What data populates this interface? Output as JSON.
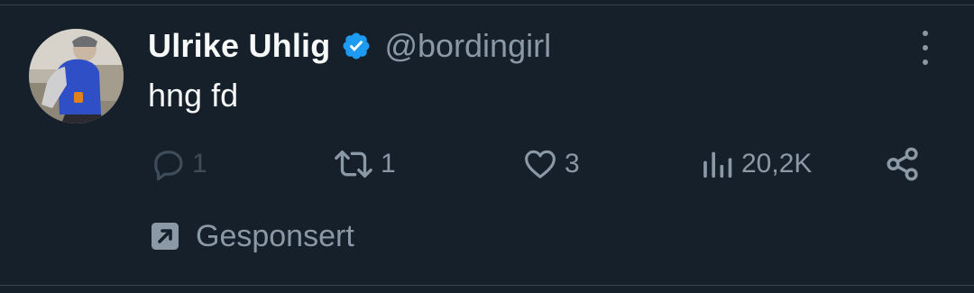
{
  "author": {
    "display_name": "Ulrike Uhlig",
    "handle": "@bordingirl",
    "verified_color": "#1d9bf0"
  },
  "tweet": {
    "text": "hng fd"
  },
  "actions": {
    "reply_count": "1",
    "retweet_count": "1",
    "like_count": "3",
    "views_count": "20,2K"
  },
  "promoted": {
    "label": "Gesponsert"
  },
  "colors": {
    "background": "#15202b",
    "primary_text": "#f7f9f9",
    "secondary_text": "#8b98a5",
    "divider": "#38444d"
  },
  "icons": {
    "more": "more-vertical-icon",
    "reply": "reply-icon",
    "retweet": "retweet-icon",
    "like": "heart-icon",
    "views": "views-icon",
    "share": "share-icon",
    "promoted": "promoted-arrow-icon",
    "verified": "verified-badge-icon"
  }
}
